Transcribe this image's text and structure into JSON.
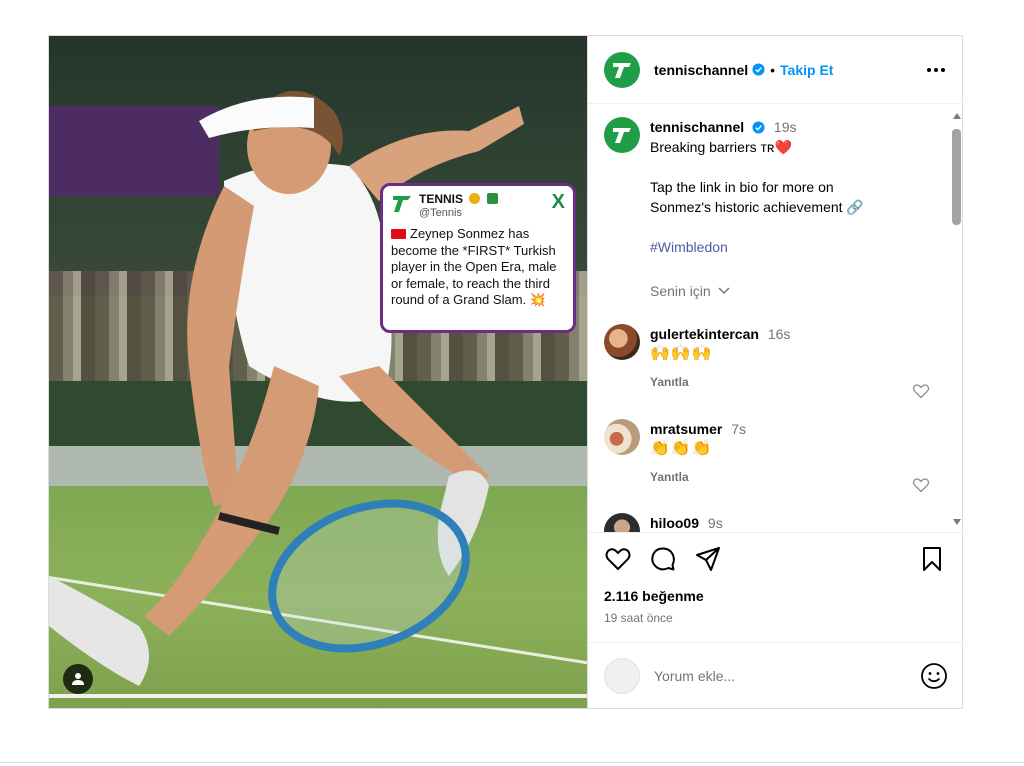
{
  "header": {
    "username": "tennischannel",
    "follow_label": "Takip Et",
    "separator": "•"
  },
  "media": {
    "tweet": {
      "name": "TENNIS",
      "handle": "@Tennis",
      "x_logo": "X",
      "text": "Zeynep Sonmez has become the *FIRST* Turkish player in the Open Era, male or female, to reach the third round of a Grand Slam. 💥"
    }
  },
  "caption": {
    "username": "tennischannel",
    "time": "19s",
    "line1": "Breaking barriers ᴛʀ❤️",
    "line2": "Tap the link in bio for more on",
    "line3": "Sonmez's historic achievement 🔗",
    "hashtag": "#Wimbledon",
    "translation": "Senin için"
  },
  "comments": [
    {
      "username": "gulertekintercan",
      "time": "16s",
      "text": "🙌🙌🙌",
      "reply": "Yanıtla"
    },
    {
      "username": "mratsumer",
      "time": "7s",
      "text": "👏👏👏",
      "reply": "Yanıtla"
    },
    {
      "username": "hiloo09",
      "time": "9s"
    }
  ],
  "actions": {
    "likes": "2.116 beğenme",
    "time_ago": "19 saat önce"
  },
  "add_comment": {
    "placeholder": "Yorum ekle..."
  },
  "colors": {
    "brand_green": "#1f9d47",
    "link_blue": "#0095f6",
    "hashtag": "#4d5aa6",
    "tweet_border": "#6b2d86"
  },
  "icons": [
    "verified-icon",
    "more-options-icon",
    "heart-icon",
    "comment-icon",
    "share-icon",
    "bookmark-icon",
    "smile-icon",
    "user-tag-icon",
    "chevron-down-icon"
  ]
}
